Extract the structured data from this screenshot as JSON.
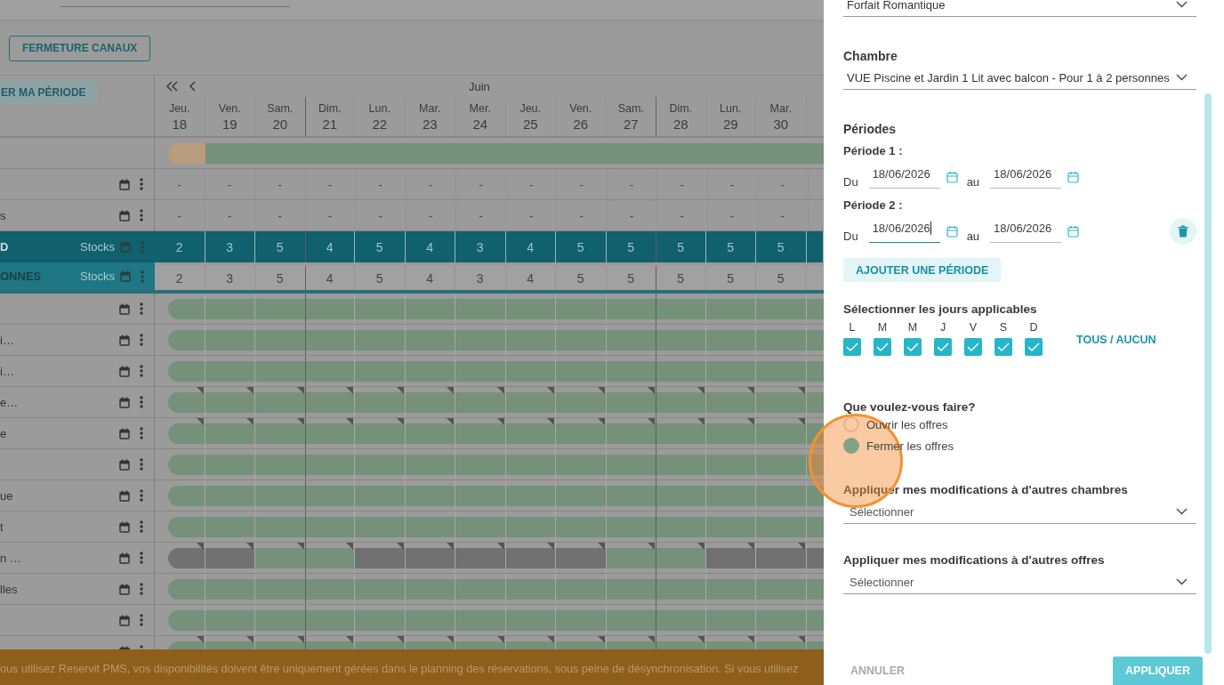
{
  "toolbar": {
    "button": "FERMETURE CANAUX"
  },
  "planning": {
    "period_button": "ER MA PÉRIODE",
    "month": "Juin",
    "days": [
      {
        "weekday": "Jeu.",
        "date": "18",
        "week_start": false
      },
      {
        "weekday": "Ven.",
        "date": "19",
        "week_start": false
      },
      {
        "weekday": "Sam.",
        "date": "20",
        "week_start": false
      },
      {
        "weekday": "Dim.",
        "date": "21",
        "week_start": true
      },
      {
        "weekday": "Lun.",
        "date": "22",
        "week_start": false
      },
      {
        "weekday": "Mar.",
        "date": "23",
        "week_start": false
      },
      {
        "weekday": "Mer.",
        "date": "24",
        "week_start": false
      },
      {
        "weekday": "Jeu.",
        "date": "25",
        "week_start": false
      },
      {
        "weekday": "Ven.",
        "date": "26",
        "week_start": false
      },
      {
        "weekday": "Sam.",
        "date": "27",
        "week_start": false
      },
      {
        "weekday": "Dim.",
        "date": "28",
        "week_start": true
      },
      {
        "weekday": "Lun.",
        "date": "29",
        "week_start": false
      },
      {
        "weekday": "Mar.",
        "date": "30",
        "week_start": false
      }
    ],
    "rows": [
      {
        "kind": "availability",
        "pending": [
          true,
          false,
          false,
          false,
          false,
          false,
          false,
          false,
          false,
          false,
          false,
          false,
          false,
          false
        ]
      },
      {
        "kind": "values",
        "values": [
          "-",
          "-",
          "-",
          "-",
          "-",
          "-",
          "-",
          "-",
          "-",
          "-",
          "-",
          "-",
          "-"
        ]
      },
      {
        "kind": "values",
        "label": "s",
        "values": [
          "-",
          "-",
          "-",
          "-",
          "-",
          "-",
          "-",
          "-",
          "-",
          "-",
          "-",
          "-",
          "-"
        ]
      },
      {
        "kind": "stock_main",
        "label": "D",
        "tag": "Stocks",
        "values": [
          "2",
          "3",
          "5",
          "4",
          "5",
          "4",
          "3",
          "4",
          "5",
          "5",
          "5",
          "5",
          "5"
        ]
      },
      {
        "kind": "stock_room",
        "label": "ONNES",
        "tag": "Stocks",
        "values": [
          "2",
          "3",
          "5",
          "4",
          "5",
          "4",
          "3",
          "4",
          "5",
          "5",
          "5",
          "5",
          "5"
        ]
      },
      {
        "kind": "offer",
        "flagged": false,
        "open": [
          true,
          true,
          true,
          true,
          true,
          true,
          true,
          true,
          true,
          true,
          true,
          true,
          true,
          true
        ]
      },
      {
        "kind": "offer",
        "label": "i…",
        "flagged": false,
        "open": [
          true,
          true,
          true,
          true,
          true,
          true,
          true,
          true,
          true,
          true,
          true,
          true,
          true,
          true
        ]
      },
      {
        "kind": "offer",
        "label": "i…",
        "flagged": false,
        "open": [
          true,
          true,
          true,
          true,
          true,
          true,
          true,
          true,
          true,
          true,
          true,
          true,
          true,
          true
        ]
      },
      {
        "kind": "offer",
        "label": "e…",
        "flagged": true,
        "open": [
          true,
          true,
          true,
          true,
          true,
          true,
          true,
          true,
          true,
          true,
          true,
          true,
          true,
          true
        ]
      },
      {
        "kind": "offer",
        "label": "e",
        "flagged": true,
        "open": [
          true,
          true,
          true,
          true,
          true,
          true,
          true,
          true,
          true,
          true,
          true,
          true,
          true,
          true
        ]
      },
      {
        "kind": "offer",
        "flagged": false,
        "open": [
          true,
          true,
          true,
          true,
          true,
          true,
          true,
          true,
          true,
          true,
          true,
          true,
          true,
          true
        ]
      },
      {
        "kind": "offer",
        "label": "ue",
        "flagged": false,
        "open": [
          true,
          true,
          true,
          true,
          true,
          true,
          true,
          true,
          true,
          true,
          true,
          true,
          true,
          true
        ]
      },
      {
        "kind": "offer",
        "label": "t",
        "flagged": false,
        "open": [
          true,
          true,
          true,
          true,
          true,
          true,
          true,
          true,
          true,
          true,
          true,
          true,
          true,
          true
        ]
      },
      {
        "kind": "offer",
        "label": "n …",
        "flagged": true,
        "open": [
          false,
          false,
          true,
          true,
          false,
          false,
          false,
          false,
          false,
          true,
          true,
          false,
          false,
          false
        ]
      },
      {
        "kind": "offer",
        "label": "lles",
        "flagged": false,
        "open": [
          true,
          true,
          true,
          true,
          true,
          true,
          true,
          true,
          true,
          true,
          true,
          true,
          true,
          true
        ]
      },
      {
        "kind": "offer",
        "flagged": false,
        "open": [
          true,
          true,
          true,
          true,
          true,
          true,
          true,
          true,
          true,
          true,
          true,
          true,
          true,
          true
        ]
      },
      {
        "kind": "offer",
        "flagged": true,
        "open": [
          true,
          true,
          true,
          true,
          true,
          true,
          true,
          true,
          true,
          true,
          true,
          true,
          true,
          true
        ]
      }
    ]
  },
  "banner": "ous utilisez Reservit PMS, vos disponibilités doivent être uniquement gérées dans le planning des réservations, sous peine de désynchronisation. Si vous utilisez",
  "drawer": {
    "offer": {
      "value": "Forfait Romantique"
    },
    "room": {
      "label": "Chambre",
      "value": "VUE Piscine et Jardin 1 Lit avec balcon - Pour 1 à 2 personnes"
    },
    "periods": {
      "title": "Périodes",
      "items": [
        {
          "label": "Période 1 :",
          "from_label": "Du",
          "from": "18/06/2026",
          "to_label": "au",
          "to": "18/06/2026",
          "focused": false,
          "deletable": false
        },
        {
          "label": "Période 2 :",
          "from_label": "Du",
          "from": "18/06/2026",
          "to_label": "au",
          "to": "18/06/2026",
          "focused": true,
          "deletable": true
        }
      ]
    },
    "add_button": "AJOUTER UNE PÉRIODE",
    "days": {
      "title": "Sélectionner les jours applicables",
      "toggle": "TOUS / AUCUN",
      "items": [
        {
          "letter": "L",
          "checked": true
        },
        {
          "letter": "M",
          "checked": true
        },
        {
          "letter": "M",
          "checked": true
        },
        {
          "letter": "J",
          "checked": true
        },
        {
          "letter": "V",
          "checked": true
        },
        {
          "letter": "S",
          "checked": true
        },
        {
          "letter": "D",
          "checked": true
        }
      ]
    },
    "action": {
      "title": "Que voulez-vous faire?",
      "options": [
        {
          "label": "Ouvrir les offres",
          "selected": false
        },
        {
          "label": "Fermer les offres",
          "selected": true
        }
      ]
    },
    "apply_rooms": {
      "label": "Appliquer mes modifications à d'autres chambres",
      "placeholder": "Sélectionner"
    },
    "apply_offers": {
      "label": "Appliquer mes modifications à d'autres offres",
      "placeholder": "Sélectionner"
    },
    "cancel": "ANNULER",
    "apply": "APPLIQUER"
  }
}
